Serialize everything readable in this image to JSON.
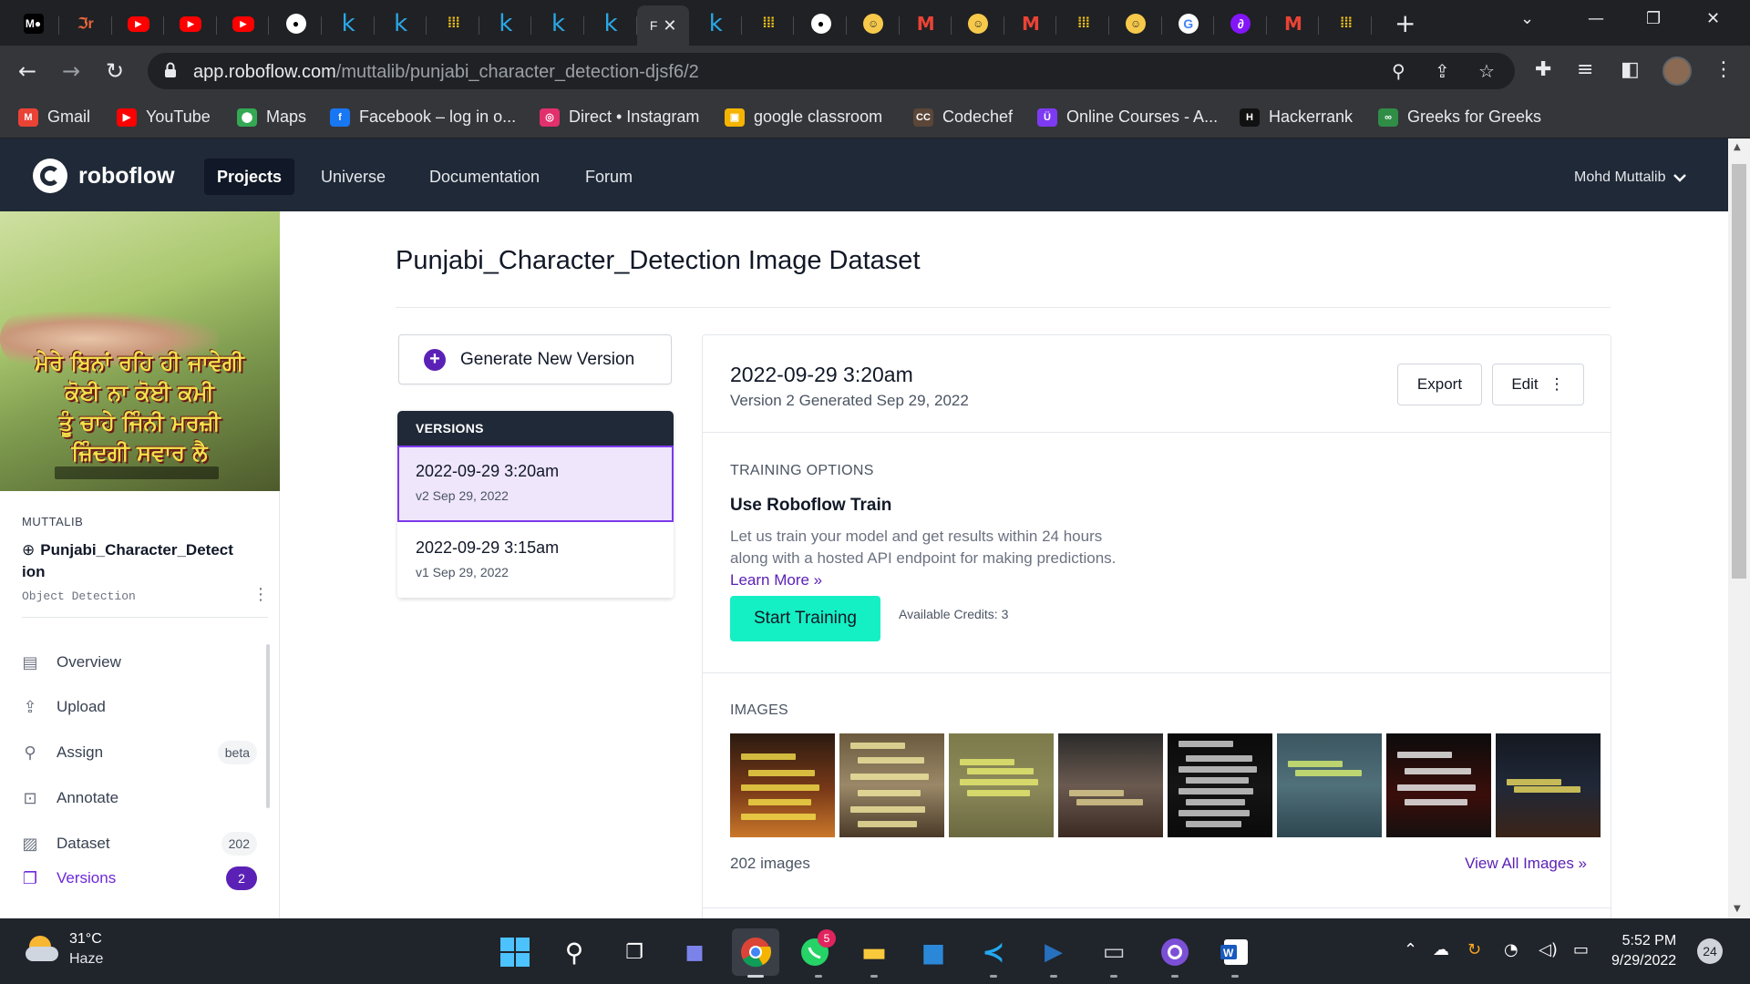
{
  "browser": {
    "tabs": [
      {
        "icon": "medium-icon",
        "glyph": "M●"
      },
      {
        "icon": "jr-icon",
        "glyph": "ℑr"
      },
      {
        "icon": "youtube-icon",
        "glyph": "▶"
      },
      {
        "icon": "youtube-icon",
        "glyph": "▶"
      },
      {
        "icon": "youtube-icon",
        "glyph": "▶"
      },
      {
        "icon": "github-icon",
        "glyph": "●"
      },
      {
        "icon": "kaggle-icon",
        "glyph": "k"
      },
      {
        "icon": "kaggle-icon",
        "glyph": "k"
      },
      {
        "icon": "grid-icon",
        "glyph": "⁞⁞⁞"
      },
      {
        "icon": "kaggle-icon",
        "glyph": "k"
      },
      {
        "icon": "kaggle-icon",
        "glyph": "k"
      },
      {
        "icon": "kaggle-icon",
        "glyph": "k"
      },
      {
        "icon": "active-tab",
        "glyph": "F"
      },
      {
        "icon": "kaggle-icon",
        "glyph": "k"
      },
      {
        "icon": "grid-icon",
        "glyph": "⁞⁞⁞"
      },
      {
        "icon": "github-icon",
        "glyph": "●"
      },
      {
        "icon": "huggingface-icon",
        "glyph": "☺"
      },
      {
        "icon": "gmail-icon",
        "glyph": "M"
      },
      {
        "icon": "huggingface-icon",
        "glyph": "☺"
      },
      {
        "icon": "gmail-icon",
        "glyph": "M"
      },
      {
        "icon": "grid-icon",
        "glyph": "⁞⁞⁞"
      },
      {
        "icon": "huggingface-icon",
        "glyph": "☺"
      },
      {
        "icon": "google-icon",
        "glyph": "G"
      },
      {
        "icon": "roboflow-icon",
        "glyph": "∂"
      },
      {
        "icon": "gmail-icon",
        "glyph": "M"
      },
      {
        "icon": "grid-icon",
        "glyph": "⁞⁞⁞"
      }
    ],
    "url_host": "app.roboflow.com",
    "url_path": "/muttalib/punjabi_character_detection-djsf6/2",
    "bookmarks": [
      {
        "label": "Gmail",
        "color": "#ea4335",
        "glyph": "M"
      },
      {
        "label": "YouTube",
        "color": "#ff0000",
        "glyph": "▶"
      },
      {
        "label": "Maps",
        "color": "#34a853",
        "glyph": "⬤"
      },
      {
        "label": "Facebook – log in o...",
        "color": "#1877f2",
        "glyph": "f"
      },
      {
        "label": "Direct • Instagram",
        "color": "#e1306c",
        "glyph": "◎"
      },
      {
        "label": "google classroom",
        "color": "#f4b400",
        "glyph": "▣"
      },
      {
        "label": "Codechef",
        "color": "#5b4638",
        "glyph": "CC"
      },
      {
        "label": "Online Courses - A...",
        "color": "#7e3af2",
        "glyph": "Ü"
      },
      {
        "label": "Hackerrank",
        "color": "#111111",
        "glyph": "H"
      },
      {
        "label": "Greeks for Greeks",
        "color": "#2f8d46",
        "glyph": "∞"
      }
    ]
  },
  "nav": {
    "brand": "roboflow",
    "links": [
      "Projects",
      "Universe",
      "Documentation",
      "Forum"
    ],
    "user": "Mohd Muttalib"
  },
  "sidebar": {
    "cover_text": [
      "ਮੇਰੇ ਬਿਨਾਂ ਰਹਿ ਹੀ ਜਾਵੇਗੀ",
      "ਕੋਈ ਨਾ ਕੋਈ ਕਮੀ",
      "ਤੂੰ ਚਾਹੇ ਜਿੰਨੀ ਮਰਜ਼ੀ",
      "ਜ਼ਿੰਦਗੀ ਸਵਾਰ ਲੈ"
    ],
    "owner": "MUTTALIB",
    "project": "Punjabi_Character_Detect ion",
    "project_type": "Object Detection",
    "items": [
      {
        "label": "Overview",
        "icon": "overview-icon",
        "glyph": "▤",
        "badge": ""
      },
      {
        "label": "Upload",
        "icon": "upload-icon",
        "glyph": "⇪",
        "badge": ""
      },
      {
        "label": "Assign",
        "icon": "search-icon",
        "glyph": "⚲",
        "badge": "beta"
      },
      {
        "label": "Annotate",
        "icon": "annotate-icon",
        "glyph": "⊡",
        "badge": ""
      },
      {
        "label": "Dataset",
        "icon": "dataset-icon",
        "glyph": "▨",
        "badge": "202"
      },
      {
        "label": "Versions",
        "icon": "versions-icon",
        "glyph": "❐",
        "badge": "2"
      }
    ]
  },
  "main": {
    "title": "Punjabi_Character_Detection Image Dataset",
    "generate_label": "Generate New Version",
    "versions_header": "VERSIONS",
    "versions": [
      {
        "date": "2022-09-29 3:20am",
        "sub": "v2 Sep 29, 2022"
      },
      {
        "date": "2022-09-29 3:15am",
        "sub": "v1 Sep 29, 2022"
      }
    ],
    "version_title": "2022-09-29 3:20am",
    "version_sub": "Version 2 Generated Sep 29, 2022",
    "export_label": "Export",
    "edit_label": "Edit",
    "training_header": "TRAINING OPTIONS",
    "train_heading": "Use Roboflow Train",
    "train_text": "Let us train your model and get results within 24 hours along with a hosted API endpoint for making predictions.",
    "learn_more": "Learn More »",
    "start_label": "Start Training",
    "credits": "Available Credits: 3",
    "images_header": "IMAGES",
    "thumbnails": [
      {
        "bg": "linear-gradient(180deg,#2a1a10 0%,#7a3a18 55%,#c9772a 100%)",
        "line": "#f5e04a"
      },
      {
        "bg": "linear-gradient(180deg,#6b5a3e 0%,#9a8868 50%,#4a3a28 100%)",
        "line": "#f2e8a0"
      },
      {
        "bg": "linear-gradient(180deg,#7c7a4a 0%,#8d8a5a 50%,#6a6840 100%)",
        "line": "#e8ec70"
      },
      {
        "bg": "linear-gradient(180deg,#2a2a2a 0%,#6a5a50 50%,#3a2a22 100%)",
        "line": "#e0d090"
      },
      {
        "bg": "linear-gradient(180deg,#0a0a0a 0%,#151515 50%,#0a0a0a 100%)",
        "line": "#d8d8d8"
      },
      {
        "bg": "linear-gradient(180deg,#3c5660 0%,#50707a 50%,#2e4650 100%)",
        "line": "#d8f070"
      },
      {
        "bg": "linear-gradient(180deg,#0c0c0c 0%,#3a0e0a 60%,#151010 100%)",
        "line": "#f4f4f4"
      },
      {
        "bg": "linear-gradient(180deg,#141820 0%,#202838 50%,#3a2418 100%)",
        "line": "#f0e060"
      }
    ],
    "image_count": "202 images",
    "view_all": "View All Images »"
  },
  "taskbar": {
    "temp": "31°C",
    "condition": "Haze",
    "time": "5:52 PM",
    "date": "9/29/2022",
    "notifications": "24",
    "whatsapp_badge": "5"
  }
}
